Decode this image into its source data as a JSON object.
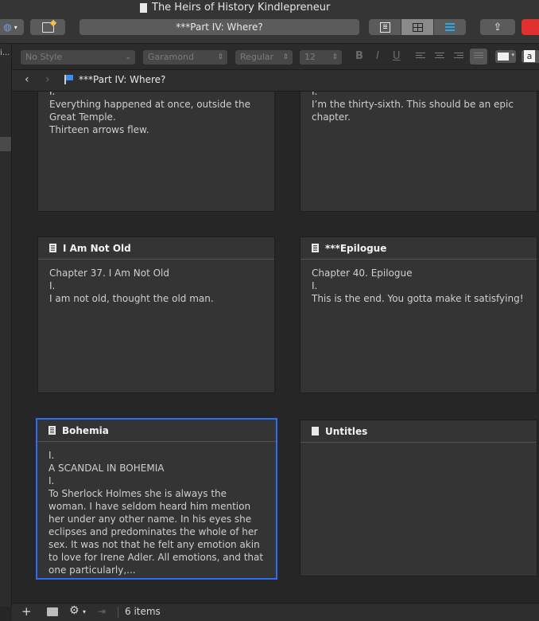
{
  "window": {
    "title": "The Heirs of History Kindlepreneur"
  },
  "toolbar": {
    "binder_label": "***Part IV: Where?"
  },
  "format": {
    "style": "No Style",
    "font": "Garamond",
    "weight": "Regular",
    "size": "12",
    "bold": "B",
    "italic": "I",
    "underline": "U",
    "text_color_label": "a"
  },
  "binder": {
    "truncated_label": "i..."
  },
  "nav": {
    "back": "‹",
    "forward": "›",
    "breadcrumb": "***Part IV: Where?"
  },
  "cards": [
    {
      "title": "",
      "body": "I.\nEverything happened at once, outside the Great Temple.\nThirteen arrows flew."
    },
    {
      "title": "",
      "body": "I.\nI’m the thirty-sixth. This should be an epic chapter."
    },
    {
      "title": "I Am Not Old",
      "body": "Chapter 37. I Am Not Old\nI.\nI am not old, thought the old man."
    },
    {
      "title": "***Epilogue",
      "body": "Chapter 40. Epilogue\nI.\nThis is the end. You gotta make it satisfying!"
    },
    {
      "title": "Bohemia",
      "body": "I.\nA SCANDAL IN BOHEMIA\nI.\nTo Sherlock Holmes she is always the woman. I have seldom heard him mention her under any other name. In his eyes she eclipses and predominates the whole of her sex. It was not that he felt any emotion akin to love for Irene Adler. All emotions, and that one particularly,..."
    },
    {
      "title": "Untitles",
      "body": ""
    }
  ],
  "status": {
    "items_count": "6 items"
  },
  "colors": {
    "selection_border": "#2f6cf5",
    "accent_blue": "#2aa8e6",
    "flag_blue": "#3a8ef0"
  }
}
